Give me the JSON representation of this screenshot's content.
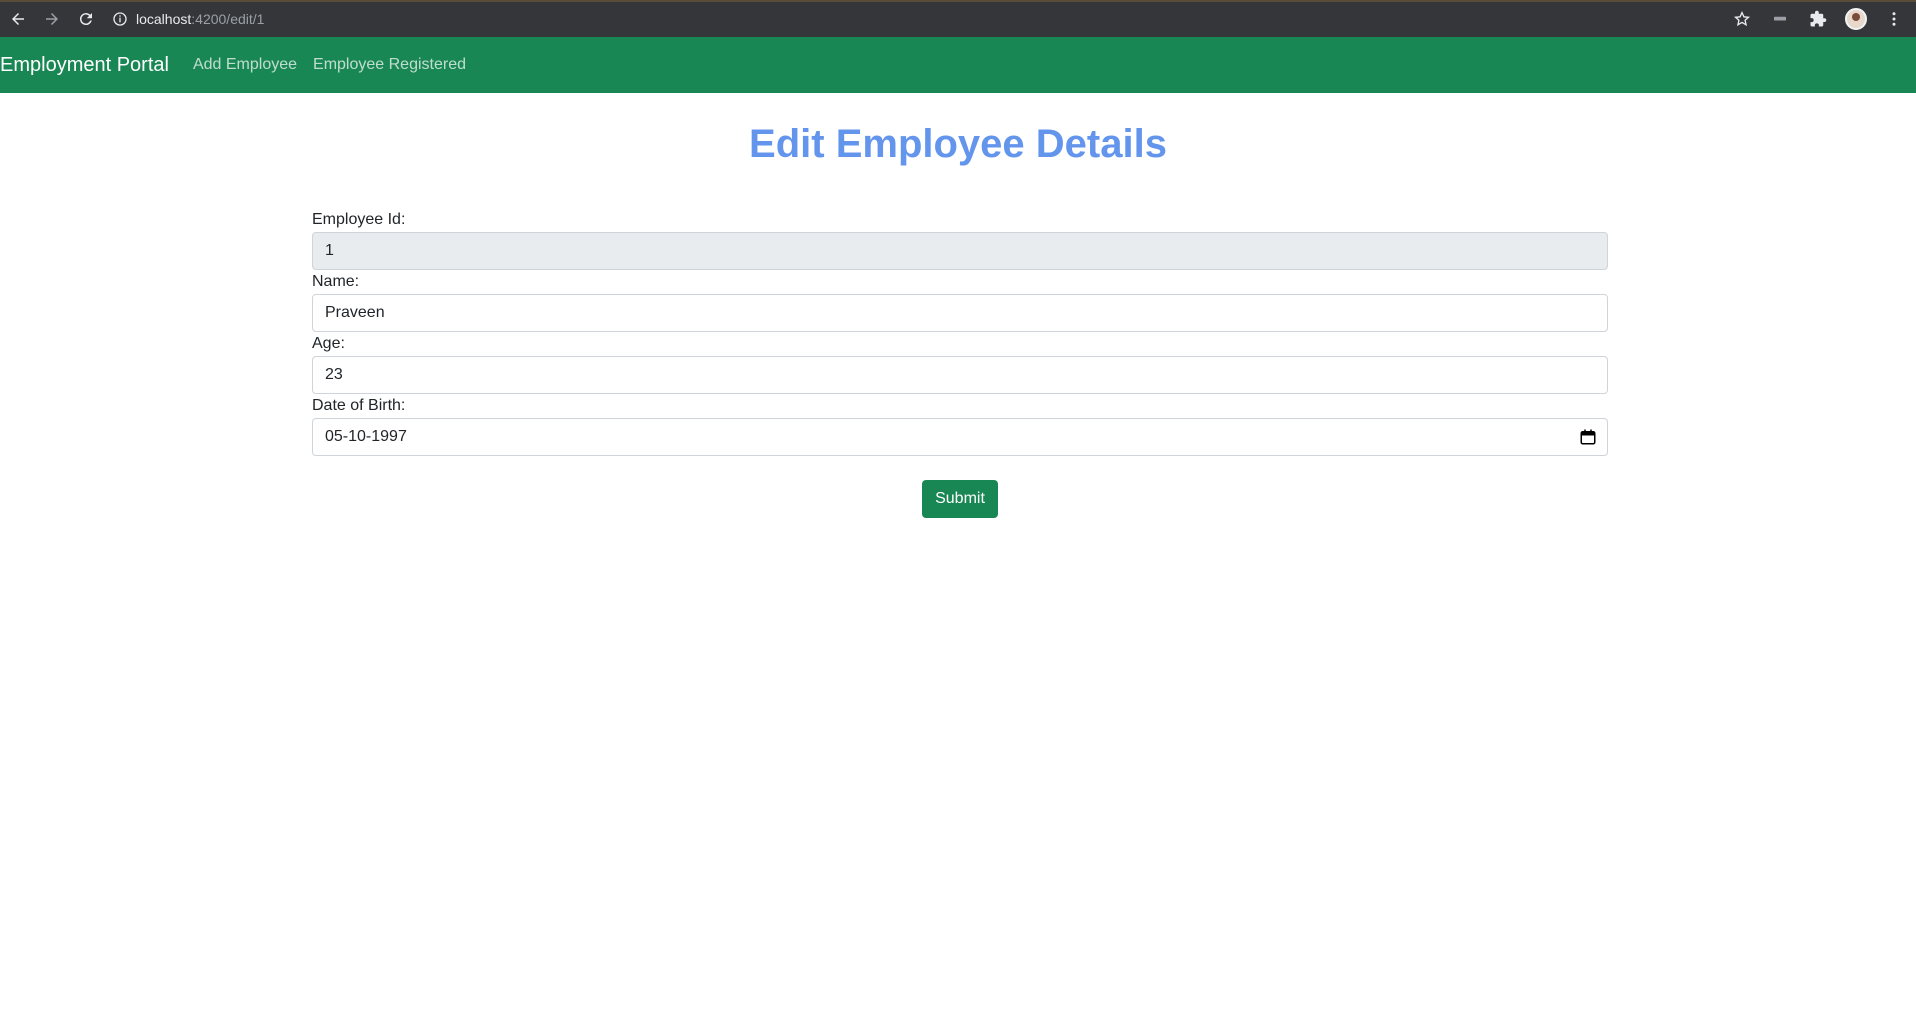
{
  "browser": {
    "url_host": "localhost",
    "url_path": ":4200/edit/1"
  },
  "navbar": {
    "brand": "Employment Portal",
    "links": [
      "Add Employee",
      "Employee Registered"
    ],
    "color": "#198754"
  },
  "page": {
    "title": "Edit Employee Details",
    "title_color": "#6495ed"
  },
  "form": {
    "employee_id_label": "Employee Id:",
    "employee_id_value": "1",
    "name_label": "Name:",
    "name_value": "Praveen",
    "age_label": "Age:",
    "age_value": "23",
    "dob_label": "Date of Birth:",
    "dob_value": "05-10-1997",
    "submit_label": "Submit"
  },
  "icons": [
    "back-icon",
    "forward-icon",
    "reload-icon",
    "info-icon",
    "star-icon",
    "tab-strip-icon",
    "extensions-icon",
    "profile-avatar",
    "menu-icon",
    "calendar-icon"
  ]
}
